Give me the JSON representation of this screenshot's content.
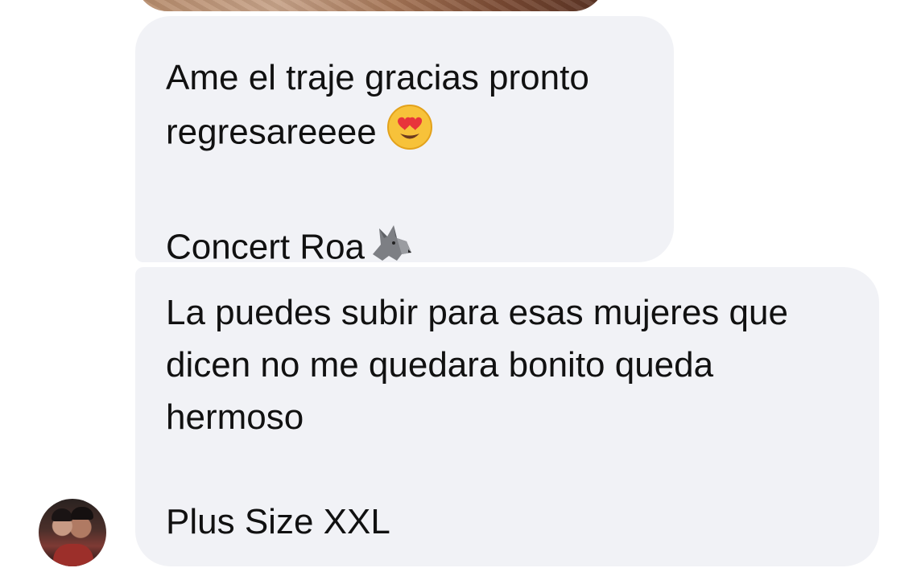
{
  "messages": [
    {
      "lines": [
        "Ame el traje gracias pronto",
        "regresareeee"
      ],
      "emoji_after_line2": "smiling-face-with-heart-eyes",
      "signature": "Concert Roa",
      "signature_emoji": "wolf"
    },
    {
      "lines": [
        "La puedes subir para esas mujeres que",
        "dicen no me quedara bonito queda",
        "hermoso"
      ],
      "size_note": "Plus Size XXL"
    }
  ],
  "colors": {
    "bubble_bg": "#f1f2f6",
    "text": "#111111"
  }
}
